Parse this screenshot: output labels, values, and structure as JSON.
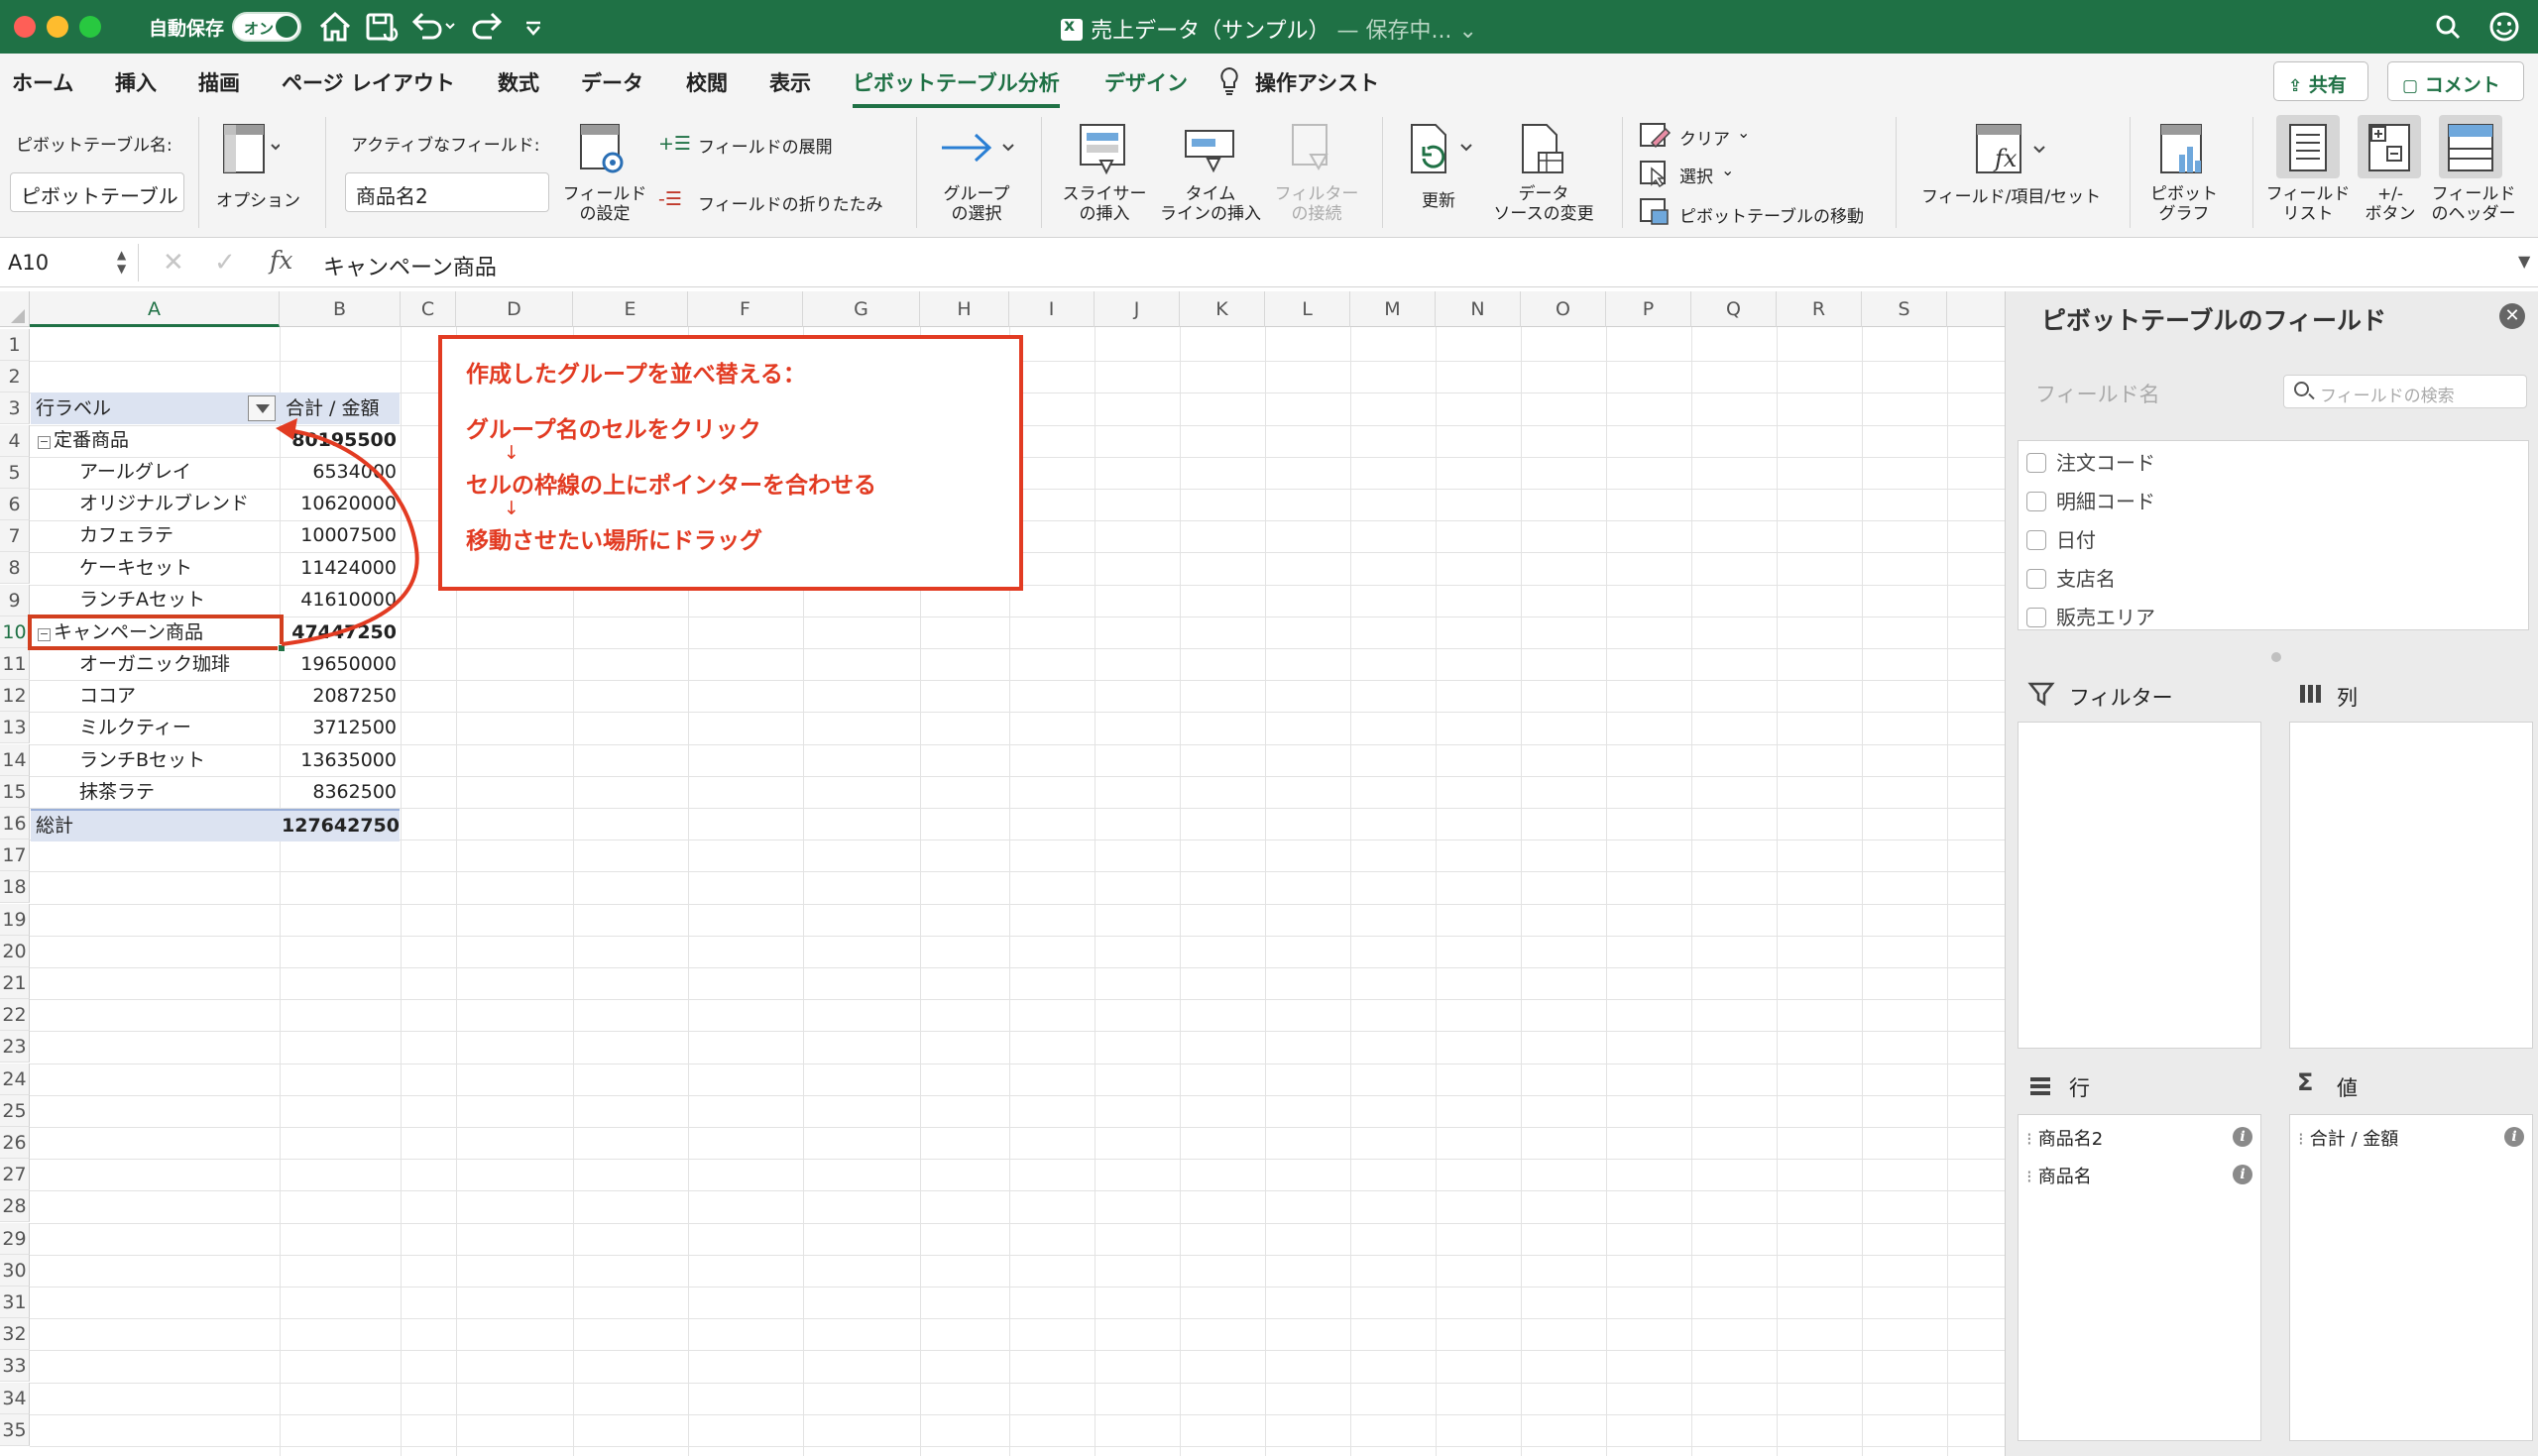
{
  "titlebar": {
    "autosave_label": "自動保存",
    "autosave_state": "オン",
    "doc_title": "売上データ（サンプル）",
    "saving_status": "— 保存中...",
    "save_chevron": "⌄"
  },
  "ribbon_tabs": [
    {
      "label": "ホーム"
    },
    {
      "label": "挿入"
    },
    {
      "label": "描画"
    },
    {
      "label": "ページ レイアウト"
    },
    {
      "label": "数式"
    },
    {
      "label": "データ"
    },
    {
      "label": "校閲"
    },
    {
      "label": "表示"
    },
    {
      "label": "ピボットテーブル分析",
      "active": true
    },
    {
      "label": "デザイン"
    }
  ],
  "tell_me": "操作アシスト",
  "share_label": "共有",
  "comment_label": "コメント",
  "ribbon": {
    "pt_name_label": "ピボットテーブル名:",
    "pt_name_value": "ピボットテーブル",
    "options_label": "オプション",
    "active_field_label": "アクティブなフィールド:",
    "active_field_value": "商品名2",
    "field_settings_label": "フィールド\nの設定",
    "expand_field_label": "フィールドの展開",
    "collapse_field_label": "フィールドの折りたたみ",
    "group_select_label": "グループ\nの選択",
    "slicer_label": "スライサー\nの挿入",
    "timeline_label": "タイム\nラインの挿入",
    "filter_connection_label": "フィルター\nの接続",
    "refresh_label": "更新",
    "change_source_label": "データ\nソースの変更",
    "clear_label": "クリア",
    "select_label": "選択",
    "move_pt_label": "ピボットテーブルの移動",
    "fields_items_label": "フィールド/項目/セット",
    "pivot_chart_label": "ピボット\nグラフ",
    "field_list_label": "フィールド\nリスト",
    "plus_minus_label": "+/-\nボタン",
    "field_headers_label": "フィールド\nのヘッダー"
  },
  "formula_bar": {
    "name_box": "A10",
    "cancel": "✕",
    "enter": "✓",
    "fx": "fx",
    "formula": "キャンペーン商品",
    "expand": "▼"
  },
  "columns": [
    "A",
    "B",
    "C",
    "D",
    "E",
    "F",
    "G",
    "H",
    "I",
    "J",
    "K",
    "L",
    "M",
    "N",
    "O",
    "P",
    "Q",
    "R",
    "S"
  ],
  "rows": [
    "1",
    "2",
    "3",
    "4",
    "5",
    "6",
    "7",
    "8",
    "9",
    "10",
    "11",
    "12",
    "13",
    "14",
    "15",
    "16",
    "17",
    "18",
    "19",
    "20",
    "21",
    "22",
    "23",
    "24",
    "25",
    "26",
    "27",
    "28",
    "29",
    "30",
    "31",
    "32",
    "33",
    "34",
    "35"
  ],
  "pivot": {
    "header_label": "行ラベル",
    "header_value": "合計 / 金額",
    "group1": {
      "label": "定番商品",
      "value": "80195500"
    },
    "group1_items": [
      {
        "label": "アールグレイ",
        "value": "6534000"
      },
      {
        "label": "オリジナルブレンド",
        "value": "10620000"
      },
      {
        "label": "カフェラテ",
        "value": "10007500"
      },
      {
        "label": "ケーキセット",
        "value": "11424000"
      },
      {
        "label": "ランチAセット",
        "value": "41610000"
      }
    ],
    "group2": {
      "label": "キャンペーン商品",
      "value": "47447250"
    },
    "group2_items": [
      {
        "label": "オーガニック珈琲",
        "value": "19650000"
      },
      {
        "label": "ココア",
        "value": "2087250"
      },
      {
        "label": "ミルクティー",
        "value": "3712500"
      },
      {
        "label": "ランチBセット",
        "value": "13635000"
      },
      {
        "label": "抹茶ラテ",
        "value": "8362500"
      }
    ],
    "total": {
      "label": "総計",
      "value": "127642750"
    },
    "collapse_symbol": "⊟"
  },
  "callout": {
    "line1": "作成したグループを並べ替える：",
    "line2": "グループ名のセルをクリック",
    "line3": "セルの枠線の上にポインターを合わせる",
    "line4": "移動させたい場所にドラッグ",
    "arrow": "↓",
    "color": "#e23b22"
  },
  "pane": {
    "title": "ピボットテーブルのフィールド",
    "close": "✕",
    "field_name_label": "フィールド名",
    "search_placeholder": "フィールドの検索",
    "fields": [
      "注文コード",
      "明細コード",
      "日付",
      "支店名",
      "販売エリア"
    ],
    "filters_label": "フィルター",
    "columns_label": "列",
    "rows_label": "行",
    "values_label": "値",
    "rows_items": [
      "商品名2",
      "商品名"
    ],
    "values_items": [
      "合計 / 金額"
    ],
    "info": "i",
    "grip": "⁝"
  },
  "colors": {
    "accent": "#1f7145",
    "selection": "#d23f1f",
    "pivot_header": "#dce3f1"
  }
}
